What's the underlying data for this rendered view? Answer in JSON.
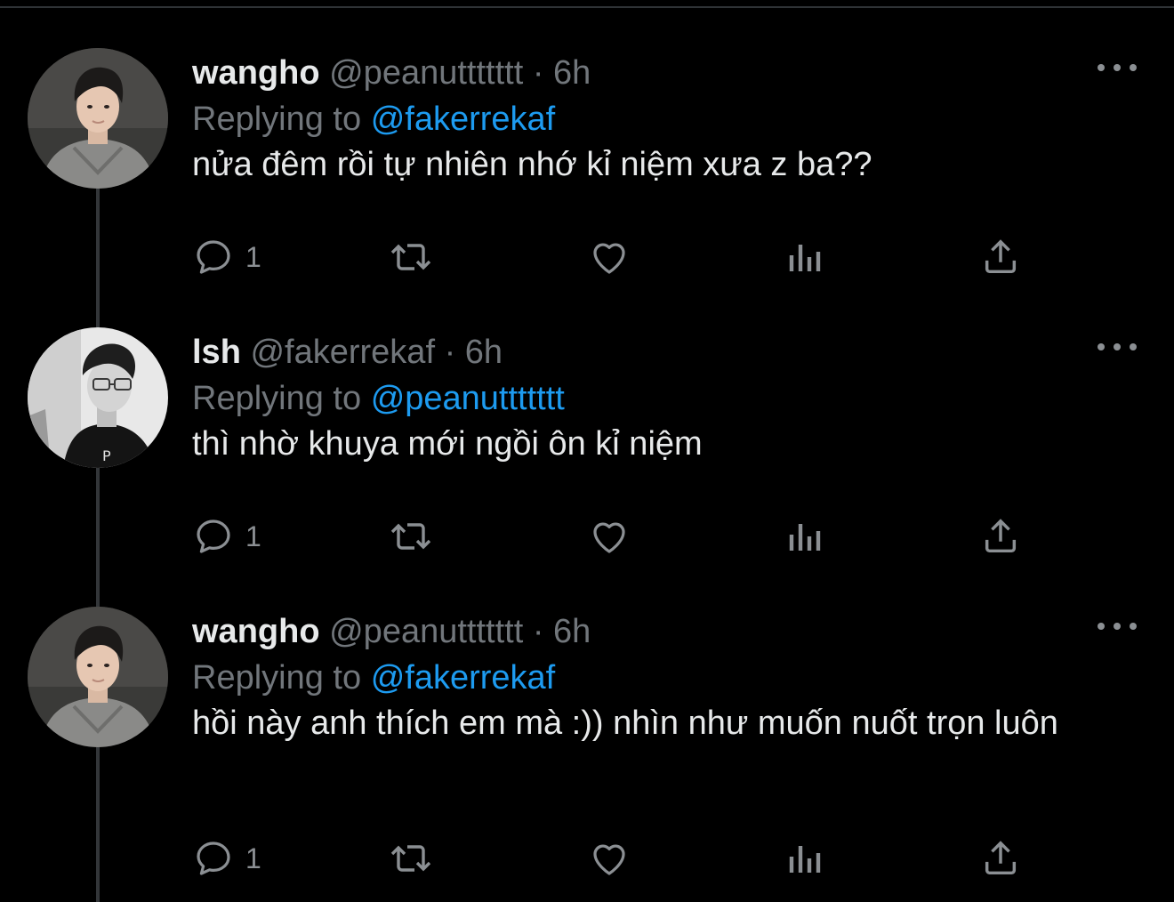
{
  "tweets": [
    {
      "name": "wangho",
      "handle": "@peanuttttttt",
      "separator": "·",
      "time": "6h",
      "replying_prefix": "Replying to",
      "replying_to": "@fakerrekaf",
      "text": "nửa đêm rồi tự nhiên nhớ kỉ niệm xưa z ba??",
      "reply_count": "1",
      "avatar": "avatar-photo-hoodie"
    },
    {
      "name": "lsh",
      "handle": "@fakerrekaf",
      "separator": "·",
      "time": "6h",
      "replying_prefix": "Replying to",
      "replying_to": "@peanuttttttt",
      "text": "thì nhờ khuya mới ngồi ôn kỉ niệm",
      "reply_count": "1",
      "avatar": "avatar-photo-glasses-bw"
    },
    {
      "name": "wangho",
      "handle": "@peanuttttttt",
      "separator": "·",
      "time": "6h",
      "replying_prefix": "Replying to",
      "replying_to": "@fakerrekaf",
      "text": "hồi này anh thích em mà :)) nhìn như muốn nuốt trọn luôn",
      "reply_count": "1",
      "avatar": "avatar-photo-hoodie"
    }
  ],
  "icons": {
    "reply": "reply-bubble-icon",
    "retweet": "retweet-icon",
    "like": "heart-icon",
    "views": "analytics-bars-icon",
    "share": "share-upload-icon",
    "more": "more-dots-icon"
  },
  "colors": {
    "background": "#000000",
    "primary_text": "#e7e9ea",
    "secondary_text": "#71767b",
    "accent": "#1d9bf0",
    "thread_line": "#333639"
  }
}
